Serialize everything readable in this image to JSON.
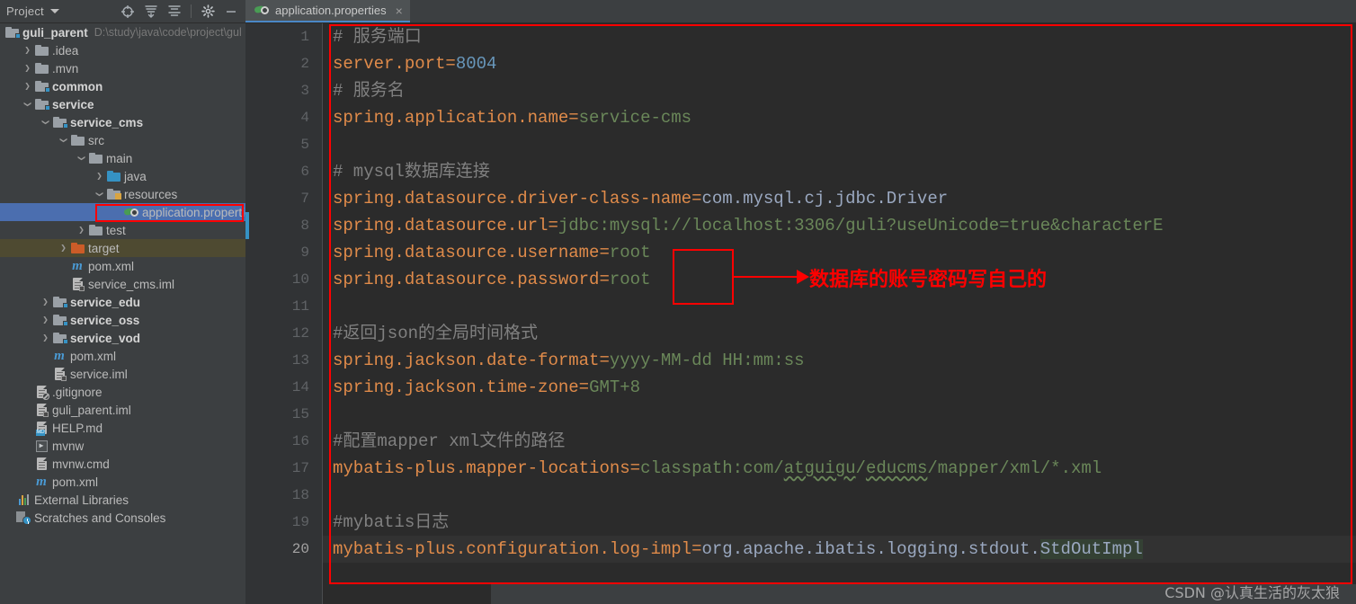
{
  "window": {
    "panel_title": "Project",
    "toolbar_icons": [
      "locate-target-icon",
      "expand-all-icon",
      "collapse-all-icon",
      "settings-gear-icon",
      "minimize-icon"
    ]
  },
  "project_tree": {
    "root": {
      "label": "guli_parent",
      "path": "D:\\study\\java\\code\\project\\gul"
    },
    "items": [
      {
        "label": ".idea",
        "indent": 1,
        "arrow": "right",
        "icon": "folder-icon",
        "bold": false
      },
      {
        "label": ".mvn",
        "indent": 1,
        "arrow": "right",
        "icon": "folder-icon",
        "bold": false
      },
      {
        "label": "common",
        "indent": 1,
        "arrow": "right",
        "icon": "module-folder-icon",
        "bold": true
      },
      {
        "label": "service",
        "indent": 1,
        "arrow": "down",
        "icon": "module-folder-icon",
        "bold": true
      },
      {
        "label": "service_cms",
        "indent": 2,
        "arrow": "down",
        "icon": "module-folder-icon",
        "bold": true
      },
      {
        "label": "src",
        "indent": 3,
        "arrow": "down",
        "icon": "folder-icon",
        "bold": false
      },
      {
        "label": "main",
        "indent": 4,
        "arrow": "down",
        "icon": "folder-icon",
        "bold": false
      },
      {
        "label": "java",
        "indent": 5,
        "arrow": "right",
        "icon": "source-folder-icon",
        "bold": false
      },
      {
        "label": "resources",
        "indent": 5,
        "arrow": "down",
        "icon": "resources-folder-icon",
        "bold": false
      },
      {
        "label": "application.properties",
        "indent": 6,
        "arrow": "none",
        "icon": "properties-file-icon",
        "bold": false,
        "selected": true,
        "annotated": true
      },
      {
        "label": "test",
        "indent": 4,
        "arrow": "right",
        "icon": "folder-icon",
        "bold": false
      },
      {
        "label": "target",
        "indent": 3,
        "arrow": "right",
        "icon": "target-folder-icon",
        "bold": false,
        "highlighted": true
      },
      {
        "label": "pom.xml",
        "indent": 3,
        "arrow": "none",
        "icon": "maven-file-icon",
        "bold": false
      },
      {
        "label": "service_cms.iml",
        "indent": 3,
        "arrow": "none",
        "icon": "iml-file-icon",
        "bold": false
      },
      {
        "label": "service_edu",
        "indent": 2,
        "arrow": "right",
        "icon": "module-folder-icon",
        "bold": true
      },
      {
        "label": "service_oss",
        "indent": 2,
        "arrow": "right",
        "icon": "module-folder-icon",
        "bold": true
      },
      {
        "label": "service_vod",
        "indent": 2,
        "arrow": "right",
        "icon": "module-folder-icon",
        "bold": true
      },
      {
        "label": "pom.xml",
        "indent": 2,
        "arrow": "none",
        "icon": "maven-file-icon",
        "bold": false
      },
      {
        "label": "service.iml",
        "indent": 2,
        "arrow": "none",
        "icon": "iml-file-icon",
        "bold": false
      },
      {
        "label": ".gitignore",
        "indent": 1,
        "arrow": "none",
        "icon": "gitignore-file-icon",
        "bold": false
      },
      {
        "label": "guli_parent.iml",
        "indent": 1,
        "arrow": "none",
        "icon": "iml-file-icon",
        "bold": false
      },
      {
        "label": "HELP.md",
        "indent": 1,
        "arrow": "none",
        "icon": "markdown-file-icon",
        "bold": false
      },
      {
        "label": "mvnw",
        "indent": 1,
        "arrow": "none",
        "icon": "script-file-icon",
        "bold": false
      },
      {
        "label": "mvnw.cmd",
        "indent": 1,
        "arrow": "none",
        "icon": "cmd-file-icon",
        "bold": false
      },
      {
        "label": "pom.xml",
        "indent": 1,
        "arrow": "none",
        "icon": "maven-file-icon",
        "bold": false
      },
      {
        "label": "External Libraries",
        "indent": 0,
        "arrow": "none",
        "icon": "external-libraries-icon",
        "bold": false
      },
      {
        "label": "Scratches and Consoles",
        "indent": 0,
        "arrow": "none",
        "icon": "scratches-icon",
        "bold": false
      }
    ]
  },
  "editor": {
    "tab": {
      "label": "application.properties",
      "icon": "properties-file-icon",
      "close": "×"
    },
    "line_numbers": [
      "1",
      "2",
      "3",
      "4",
      "5",
      "6",
      "7",
      "8",
      "9",
      "10",
      "11",
      "12",
      "13",
      "14",
      "15",
      "16",
      "17",
      "18",
      "19",
      "20"
    ],
    "current_line": 20,
    "lines": [
      {
        "n": 1,
        "text": "# 服务端口"
      },
      {
        "n": 2,
        "text": "server.port=8004"
      },
      {
        "n": 3,
        "text": "# 服务名"
      },
      {
        "n": 4,
        "text": "spring.application.name=service-cms"
      },
      {
        "n": 5,
        "text": ""
      },
      {
        "n": 6,
        "text": "# mysql数据库连接"
      },
      {
        "n": 7,
        "text": "spring.datasource.driver-class-name=com.mysql.cj.jdbc.Driver"
      },
      {
        "n": 8,
        "text": "spring.datasource.url=jdbc:mysql://localhost:3306/guli?useUnicode=true&characterE"
      },
      {
        "n": 9,
        "text": "spring.datasource.username=root"
      },
      {
        "n": 10,
        "text": "spring.datasource.password=root"
      },
      {
        "n": 11,
        "text": ""
      },
      {
        "n": 12,
        "text": "#返回json的全局时间格式"
      },
      {
        "n": 13,
        "text": "spring.jackson.date-format=yyyy-MM-dd HH:mm:ss"
      },
      {
        "n": 14,
        "text": "spring.jackson.time-zone=GMT+8"
      },
      {
        "n": 15,
        "text": ""
      },
      {
        "n": 16,
        "text": "#配置mapper xml文件的路径"
      },
      {
        "n": 17,
        "text": "mybatis-plus.mapper-locations=classpath:com/atguigu/educms/mapper/xml/*.xml"
      },
      {
        "n": 18,
        "text": ""
      },
      {
        "n": 19,
        "text": "#mybatis日志"
      },
      {
        "n": 20,
        "text": "mybatis-plus.configuration.log-impl=org.apache.ibatis.logging.stdout.StdOutImpl"
      }
    ],
    "tokens": {
      "l1_comment": "# 服务端口",
      "l2_key": "server.port",
      "l2_eq": "=",
      "l2_num": "8004",
      "l3_comment": "# 服务名",
      "l4_key": "spring.application.name",
      "l4_eq": "=",
      "l4_val": "service-cms",
      "l6_comment": "# mysql数据库连接",
      "l7_key": "spring.datasource.driver-class-name",
      "l7_eq": "=",
      "l7_val": "com.mysql.cj.jdbc.Driver",
      "l8_key": "spring.datasource.url",
      "l8_eq": "=",
      "l8_val": "jdbc:mysql://localhost:3306/guli?useUnicode=true&characterE",
      "l9_key": "spring.datasource.username",
      "l9_eq": "=",
      "l9_val": "root",
      "l10_key": "spring.datasource.password",
      "l10_eq": "=",
      "l10_val": "root",
      "l12_comment": "#返回json的全局时间格式",
      "l13_key": "spring.jackson.date-format",
      "l13_eq": "=",
      "l13_val": "yyyy-MM-dd HH:mm:ss",
      "l14_key": "spring.jackson.time-zone",
      "l14_eq": "=",
      "l14_val": "GMT+8",
      "l16_comment": "#配置mapper xml文件的路径",
      "l17_key": "mybatis-plus.mapper-locations",
      "l17_eq": "=",
      "l17_v1": "classpath:com/",
      "l17_v2": "atguigu",
      "l17_v3": "/",
      "l17_v4": "educms",
      "l17_v5": "/mapper/xml/*.xml",
      "l19_comment": "#mybatis日志",
      "l20_key": "mybatis-plus.configuration.log-impl",
      "l20_eq": "=",
      "l20_v1": "org.apache.ibatis.logging.stdout.",
      "l20_v2": "StdOutImpl"
    }
  },
  "annotations": {
    "arrow_text": "数据库的账号密码写自己的",
    "watermark": "CSDN @认真生活的灰太狼"
  },
  "colors": {
    "selection_blue": "#4b6eaf",
    "annotation_red": "#ff0000",
    "key_orange": "#e08b4a",
    "value_green": "#6a8759",
    "number_blue": "#6897bb",
    "comment_gray": "#808080",
    "editor_bg": "#2b2b2b",
    "panel_bg": "#3c3f41"
  }
}
